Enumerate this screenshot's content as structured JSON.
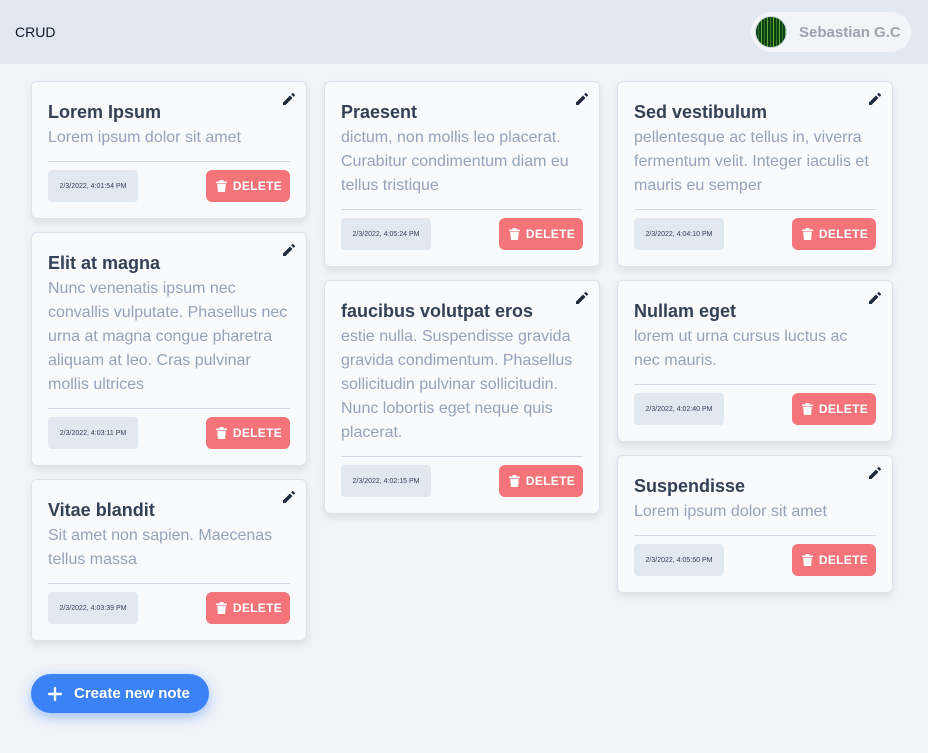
{
  "header": {
    "brand": "CRUD",
    "user_name": "Sebastian G.C"
  },
  "colors": {
    "delete_button": "#f47479",
    "create_button": "#3b82f6",
    "topbar": "#e2e8f0"
  },
  "actions": {
    "delete_label": "DELETE",
    "create_label": "Create new note"
  },
  "columns": [
    [
      {
        "title": "Lorem Ipsum",
        "text": "Lorem ipsum dolor sit amet",
        "date": "2/3/2022, 4:01:54 PM"
      },
      {
        "title": "Elit at magna",
        "text": "Nunc venenatis ipsum nec convallis vulputate. Phasellus nec urna at magna congue pharetra aliquam at leo. Cras pulvinar mollis ultrices",
        "date": "2/3/2022, 4:03:11 PM"
      },
      {
        "title": "Vitae blandit",
        "text": "Sit amet non sapien. Maecenas tellus massa",
        "date": "2/3/2022, 4:03:39 PM"
      }
    ],
    [
      {
        "title": "Praesent",
        "text": "dictum, non mollis leo placerat. Curabitur condimentum diam eu tellus tristique",
        "date": "2/3/2022, 4:05:24 PM"
      },
      {
        "title": "faucibus volutpat eros",
        "text": "estie nulla. Suspendisse gravida gravida condimentum. Phasellus sollicitudin pulvinar sollicitudin. Nunc lobortis eget neque quis placerat.",
        "date": "2/3/2022, 4:02:15 PM"
      }
    ],
    [
      {
        "title": "Sed vestibulum",
        "text": "pellentesque ac tellus in, viverra fermentum velit. Integer iaculis et mauris eu semper",
        "date": "2/3/2022, 4:04:10 PM"
      },
      {
        "title": "Nullam eget",
        "text": "lorem ut urna cursus luctus ac nec mauris.",
        "date": "2/3/2022, 4:02:40 PM"
      },
      {
        "title": "Suspendisse",
        "text": "Lorem ipsum dolor sit amet",
        "date": "2/3/2022, 4:05:50 PM"
      }
    ]
  ]
}
